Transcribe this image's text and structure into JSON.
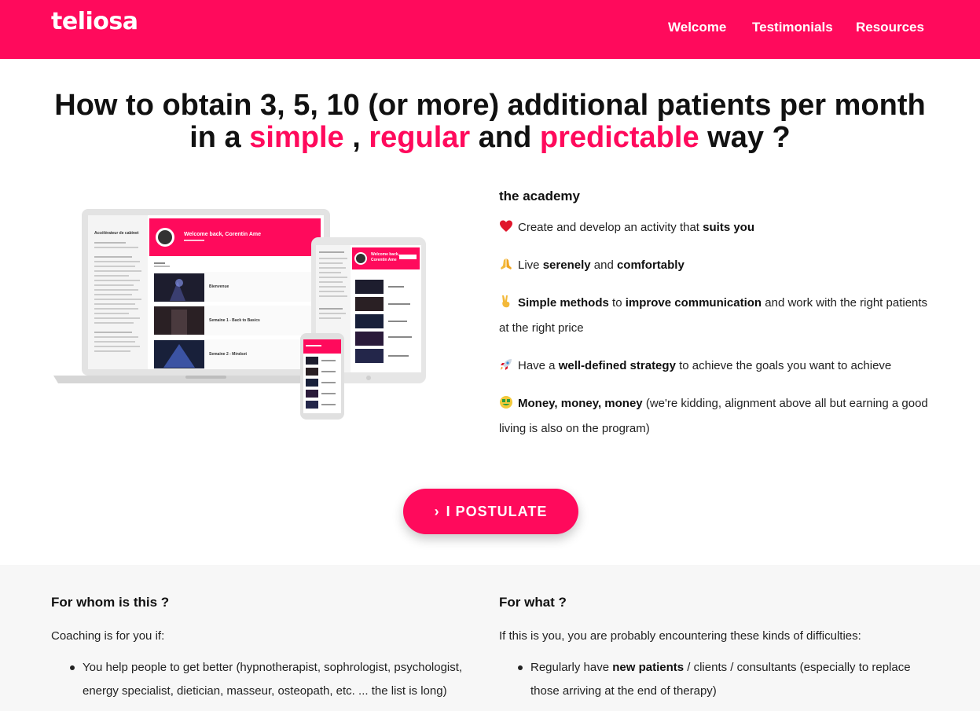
{
  "brand": {
    "logo": "teliosa",
    "accent": "#ff0a5c"
  },
  "nav": [
    "Welcome",
    "Testimonials",
    "Resources"
  ],
  "headline": {
    "line1": "How to obtain 3, 5, 10 (or more) additional patients per month",
    "in_a": "in a",
    "w1": "simple",
    "comma": ",",
    "w2": "regular",
    "and": "and",
    "w3": "predictable",
    "end": "way ?"
  },
  "mockup": {
    "sidebar_title": "Accélérateur de cabinet",
    "welcome": "Welcome back, Corentin Ame",
    "rows": [
      "Bienvenue",
      "Semaine 1 - Back to Basics",
      "Semaine 2 - Mindset"
    ],
    "tablet_welcome_1": "Welcome back,",
    "tablet_welcome_2": "Corentin Ame"
  },
  "features": {
    "title": "the academy",
    "f1": {
      "icon": "heart-icon",
      "a": "Create and develop an activity that",
      "b": "suits you"
    },
    "f2": {
      "icon": "pray-icon",
      "a": "Live",
      "b": "serenely",
      "c": "and",
      "d": "comfortably"
    },
    "f3": {
      "icon": "victory-hand-icon",
      "a": "Simple methods",
      "b": "to",
      "c": "improve communication",
      "d": "and work with the right patients at the right price"
    },
    "f4": {
      "icon": "rocket-icon",
      "a": "Have a",
      "b": "well-defined strategy",
      "c": "to achieve the goals you want to achieve"
    },
    "f5": {
      "icon": "money-face-icon",
      "a": "Money, money, money",
      "b": "(we're kidding, alignment above all but earning a good living is also on the program)"
    }
  },
  "cta": {
    "chevron": "›",
    "label": "I POSTULATE"
  },
  "whom": {
    "title": "For whom is this ?",
    "intro": "Coaching is for you if:",
    "item1": "You help people to get better (hypnotherapist, sophrologist, psychologist, energy specialist, dietician, masseur, osteopath, etc. ... the list is long)"
  },
  "what": {
    "title": "For what ?",
    "intro": "If this is you, you are probably encountering these kinds of difficulties:",
    "item1_a": "Regularly have",
    "item1_b": "new patients",
    "item1_c": "/ clients / consultants (especially to replace those arriving at the end of therapy)"
  }
}
